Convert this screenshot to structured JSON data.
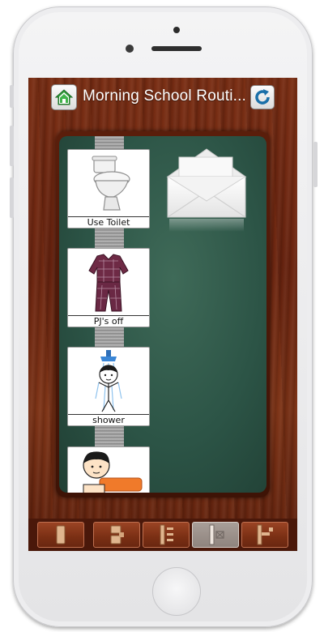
{
  "header": {
    "title": "Morning School Routi...",
    "home_icon": "home-icon",
    "refresh_icon": "refresh-icon"
  },
  "board": {
    "cards": [
      {
        "label": "Use Toilet",
        "icon": "toilet-icon"
      },
      {
        "label": "PJ's off",
        "icon": "pajamas-icon"
      },
      {
        "label": "shower",
        "icon": "shower-icon"
      },
      {
        "label": "",
        "icon": "child-dressing-icon"
      }
    ],
    "envelope_icon": "envelope-icon"
  },
  "toolbar": {
    "buttons": [
      {
        "icon": "single-panel-icon",
        "active": false
      },
      {
        "icon": "two-step-icon",
        "active": false
      },
      {
        "icon": "list-icon",
        "active": false
      },
      {
        "icon": "checklist-icon",
        "active": true
      },
      {
        "icon": "first-then-icon",
        "active": false
      }
    ]
  },
  "colors": {
    "wood": "#6a2410",
    "board": "#2c5446",
    "active_button": "#a89e98"
  }
}
